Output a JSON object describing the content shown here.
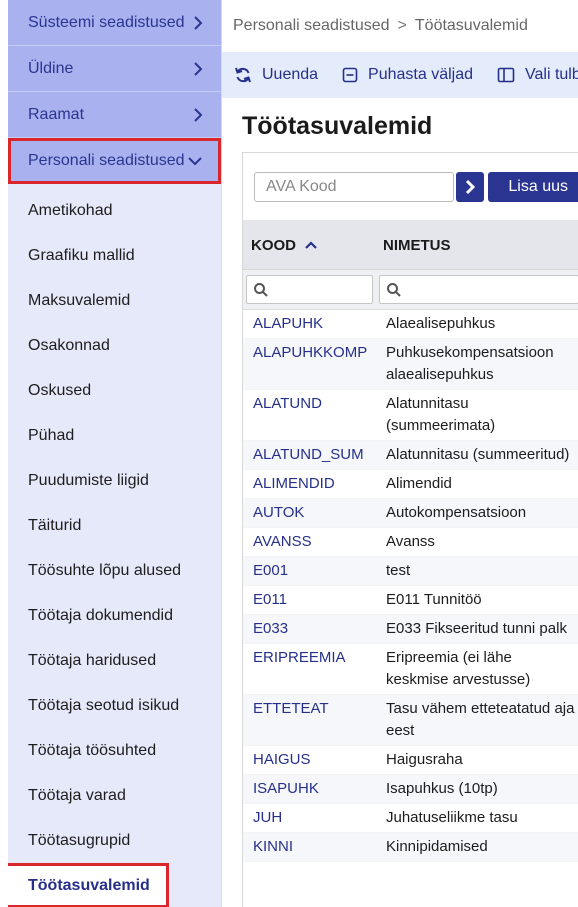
{
  "sidebar": {
    "sections": [
      {
        "label": "Süsteemi seadistused"
      },
      {
        "label": "Üldine"
      },
      {
        "label": "Raamat"
      },
      {
        "label": "Personali seadistused"
      }
    ],
    "items": [
      {
        "label": "Ametikohad"
      },
      {
        "label": "Graafiku mallid"
      },
      {
        "label": "Maksuvalemid"
      },
      {
        "label": "Osakonnad"
      },
      {
        "label": "Oskused"
      },
      {
        "label": "Pühad"
      },
      {
        "label": "Puudumiste liigid"
      },
      {
        "label": "Täiturid"
      },
      {
        "label": "Töösuhte lõpu alused"
      },
      {
        "label": "Töötaja dokumendid"
      },
      {
        "label": "Töötaja haridused"
      },
      {
        "label": "Töötaja seotud isikud"
      },
      {
        "label": "Töötaja töösuhted"
      },
      {
        "label": "Töötaja varad"
      },
      {
        "label": "Töötasugrupid"
      },
      {
        "label": "Töötasuvalemid"
      }
    ]
  },
  "breadcrumb": {
    "parent": "Personali seadistused",
    "separator": ">",
    "current": "Töötasuvalemid"
  },
  "toolbar": {
    "refresh": "Uuenda",
    "clear": "Puhasta väljad",
    "columns": "Vali tulb"
  },
  "page": {
    "title": "Töötasuvalemid"
  },
  "grid": {
    "ava_placeholder": "AVA Kood",
    "add_label": "Lisa uus",
    "col_code": "KOOD",
    "col_name": "NIMETUS",
    "rows": [
      {
        "code": "ALAPUHK",
        "name": "Alaealisepuhkus"
      },
      {
        "code": "ALAPUHKKOMP",
        "name": "Puhkusekompensatsioon alaealisepuhkus"
      },
      {
        "code": "ALATUND",
        "name": "Alatunnitasu (summeerimata)"
      },
      {
        "code": "ALATUND_SUM",
        "name": "Alatunnitasu (summeeritud)"
      },
      {
        "code": "ALIMENDID",
        "name": "Alimendid"
      },
      {
        "code": "AUTOK",
        "name": "Autokompensatsioon"
      },
      {
        "code": "AVANSS",
        "name": "Avanss"
      },
      {
        "code": "E001",
        "name": "test"
      },
      {
        "code": "E011",
        "name": "E011 Tunnitöö"
      },
      {
        "code": "E033",
        "name": "E033 Fikseeritud tunni palk"
      },
      {
        "code": "ERIPREEMIA",
        "name": "Eripreemia (ei lähe keskmise arvestusse)"
      },
      {
        "code": "ETTETEAT",
        "name": "Tasu vähem etteteatatud aja eest"
      },
      {
        "code": "HAIGUS",
        "name": "Haigusraha"
      },
      {
        "code": "ISAPUHK",
        "name": "Isapuhkus (10tp)"
      },
      {
        "code": "JUH",
        "name": "Juhatuseliikme tasu"
      },
      {
        "code": "KINNI",
        "name": "Kinnipidamised"
      }
    ]
  },
  "colors": {
    "accent": "#2a3591",
    "sidebar_bg": "#e6e9fa",
    "section_bg": "#a9b1ef",
    "highlight": "#d9262a"
  }
}
